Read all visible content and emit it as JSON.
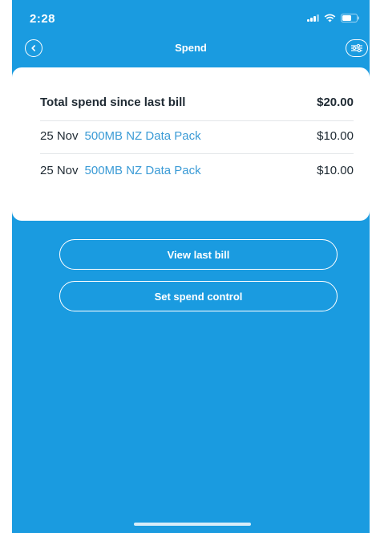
{
  "status_bar": {
    "time": "2:28",
    "icons": [
      "signal-icon",
      "wifi-icon",
      "battery-icon"
    ]
  },
  "nav": {
    "title": "Spend",
    "back_icon": "chevron-left-icon",
    "settings_icon": "sliders-icon"
  },
  "summary": {
    "label": "Total spend since last bill",
    "amount": "$20.00"
  },
  "transactions": [
    {
      "date": "25 Nov",
      "description": "500MB NZ Data Pack",
      "amount": "$10.00"
    },
    {
      "date": "25 Nov",
      "description": "500MB NZ Data Pack",
      "amount": "$10.00"
    }
  ],
  "actions": {
    "view_last_bill": "View last bill",
    "set_spend_control": "Set spend control"
  },
  "colors": {
    "background": "#1a9be0",
    "card": "#ffffff",
    "link": "#3b9bd6",
    "text": "#1f2a33"
  }
}
